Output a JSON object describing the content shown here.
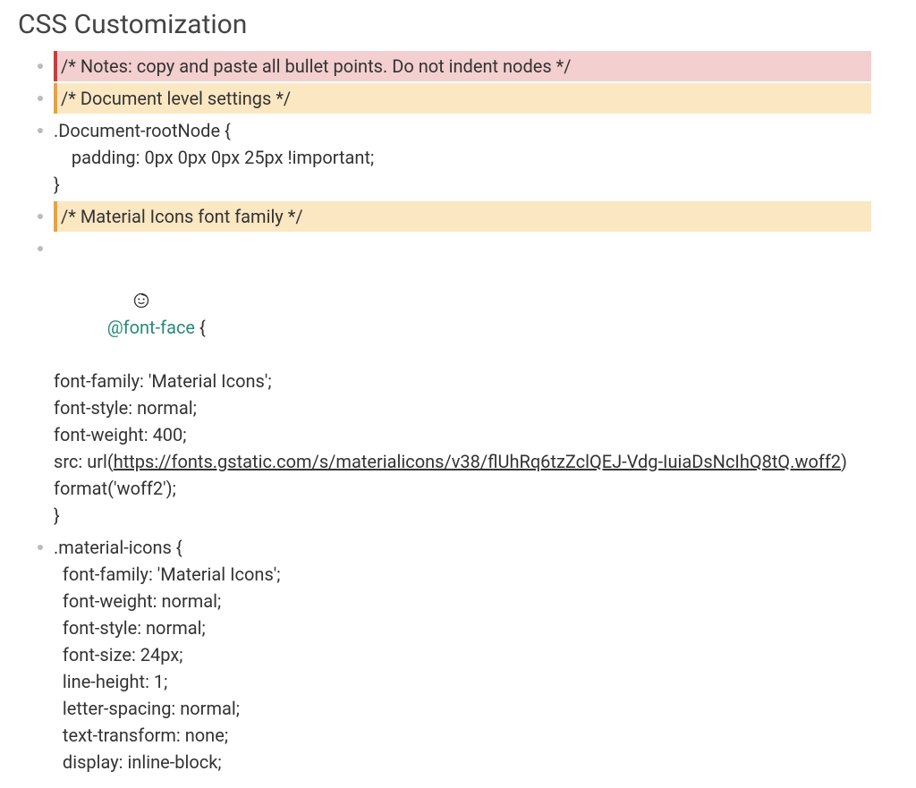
{
  "title": "CSS Customization",
  "items": [
    {
      "type": "comment-red",
      "text": "/* Notes: copy and paste all bullet points. Do not indent nodes */"
    },
    {
      "type": "comment-orange",
      "text": "/* Document level settings */"
    },
    {
      "type": "code",
      "lines": [
        ".Document-rootNode {",
        "    padding: 0px 0px 0px 25px !important;",
        "}"
      ]
    },
    {
      "type": "comment-orange",
      "text": "/* Material Icons font family */"
    },
    {
      "type": "font-face",
      "atRule": "@font-face",
      "open": " {",
      "lines_before_url": [
        "font-family: 'Material Icons';",
        "font-style: normal;",
        "font-weight: 400;"
      ],
      "src_prefix": "src: url(",
      "url": "https://fonts.gstatic.com/s/materialicons/v38/flUhRq6tzZclQEJ-Vdg-IuiaDsNcIhQ8tQ.woff2",
      "src_suffix": ") format('woff2');",
      "close": "}"
    },
    {
      "type": "code",
      "lines": [
        ".material-icons {",
        "  font-family: 'Material Icons';",
        "  font-weight: normal;",
        "  font-style: normal;",
        "  font-size: 24px;",
        "  line-height: 1;",
        "  letter-spacing: normal;",
        "  text-transform: none;",
        "  display: inline-block;"
      ]
    }
  ]
}
